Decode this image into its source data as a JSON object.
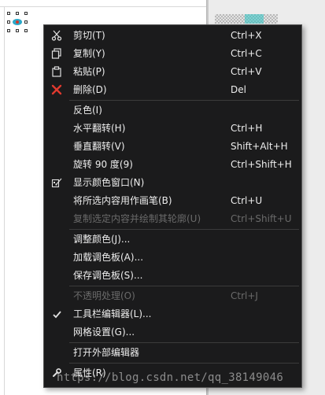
{
  "colors": {
    "menu_background": "#1b1b1c",
    "menu_text": "#ededed",
    "disabled_text": "#6a6a6a",
    "delete_icon": "#e03a2f",
    "separator": "#3b3b3b"
  },
  "menu": {
    "items": [
      {
        "label": "剪切(T)",
        "shortcut": "Ctrl+X",
        "icon": "cut-icon"
      },
      {
        "label": "复制(Y)",
        "shortcut": "Ctrl+C",
        "icon": "copy-icon"
      },
      {
        "label": "粘贴(P)",
        "shortcut": "Ctrl+V",
        "icon": "paste-icon"
      },
      {
        "label": "删除(D)",
        "shortcut": "Del",
        "icon": "delete-icon"
      },
      {
        "label": "反色(I)",
        "shortcut": ""
      },
      {
        "label": "水平翻转(H)",
        "shortcut": "Ctrl+H"
      },
      {
        "label": "垂直翻转(V)",
        "shortcut": "Shift+Alt+H"
      },
      {
        "label": "旋转 90 度(9)",
        "shortcut": "Ctrl+Shift+H"
      },
      {
        "label": "显示颜色窗口(N)",
        "shortcut": "",
        "icon": "color-window-icon"
      },
      {
        "label": "将所选内容用作画笔(B)",
        "shortcut": "Ctrl+U"
      },
      {
        "label": "复制选定内容并绘制其轮廓(U)",
        "shortcut": "Ctrl+Shift+U",
        "disabled": true
      },
      {
        "label": "调整颜色(J)...",
        "shortcut": ""
      },
      {
        "label": "加载调色板(A)...",
        "shortcut": ""
      },
      {
        "label": "保存调色板(S)...",
        "shortcut": ""
      },
      {
        "label": "不透明处理(O)",
        "shortcut": "Ctrl+J",
        "disabled": true
      },
      {
        "label": "工具栏编辑器(L)...",
        "shortcut": "",
        "icon": "checkmark-icon"
      },
      {
        "label": "网格设置(G)...",
        "shortcut": ""
      },
      {
        "label": "打开外部编辑器",
        "shortcut": ""
      },
      {
        "label": "属性(R)",
        "shortcut": "",
        "icon": "wrench-icon"
      }
    ]
  },
  "watermark": "https://blog.csdn.net/qq_38149046"
}
